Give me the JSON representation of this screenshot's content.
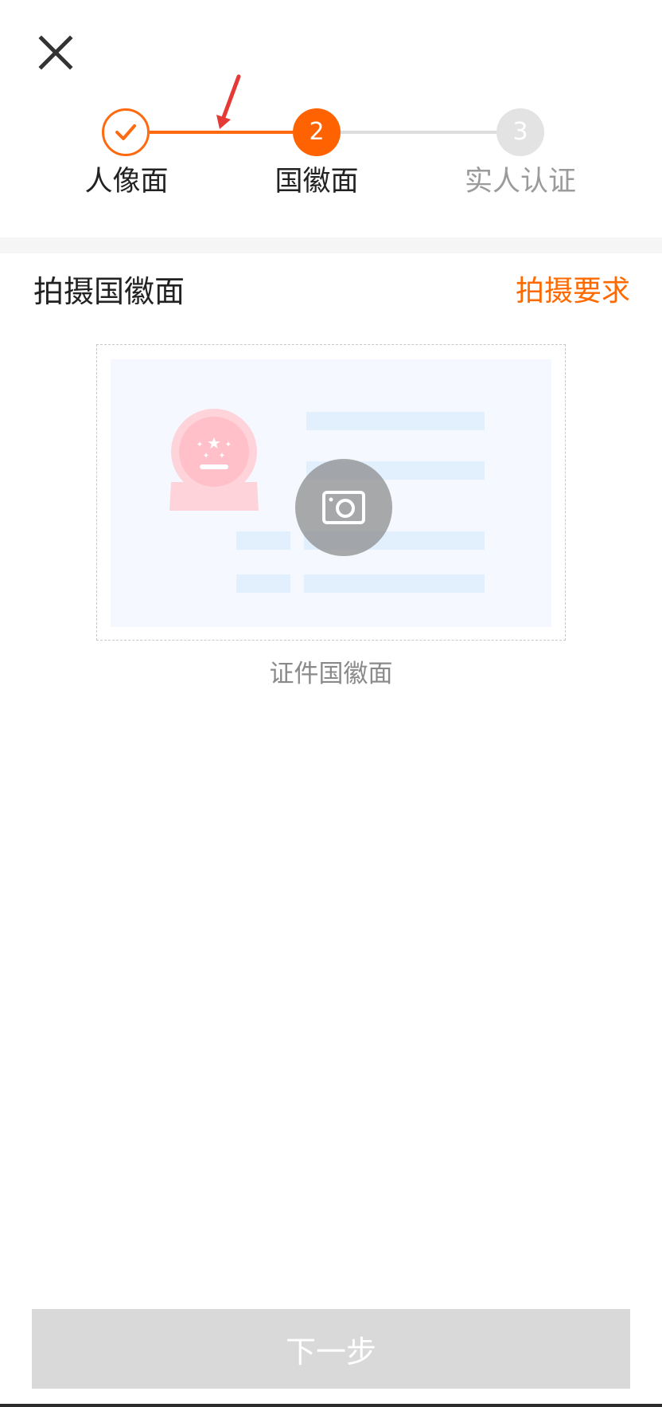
{
  "close": {
    "icon": "close-icon"
  },
  "stepper": {
    "steps": [
      {
        "label": "人像面",
        "state": "done",
        "icon": "check-icon"
      },
      {
        "label": "国徽面",
        "state": "active",
        "number": "2"
      },
      {
        "label": "实人认证",
        "state": "todo",
        "number": "3"
      }
    ],
    "accent_color": "#ff6a10"
  },
  "section": {
    "title": "拍摄国徽面",
    "requirements_link": "拍摄要求"
  },
  "upload": {
    "caption": "证件国徽面",
    "icon": "camera-icon",
    "emblem_icon": "national-emblem-icon"
  },
  "footer": {
    "next_label": "下一步",
    "disabled": true
  },
  "annotation": {
    "icon": "red-arrow-icon",
    "color": "#e53935"
  }
}
